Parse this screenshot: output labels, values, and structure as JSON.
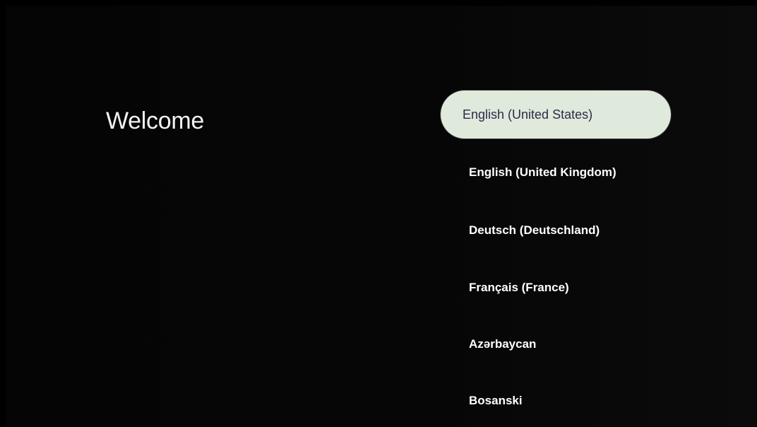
{
  "title": "Welcome",
  "languages": [
    {
      "label": "English (United States)",
      "focused": true
    },
    {
      "label": "English (United Kingdom)",
      "focused": false
    },
    {
      "label": "Deutsch (Deutschland)",
      "focused": false
    },
    {
      "label": "Français (France)",
      "focused": false
    },
    {
      "label": "Azərbaycan",
      "focused": false
    },
    {
      "label": "Bosanski",
      "focused": false
    }
  ],
  "colors": {
    "background": "#000000",
    "focus_pill": "#dfe9dc",
    "focus_text": "#2c2c46",
    "text": "#ffffff"
  }
}
